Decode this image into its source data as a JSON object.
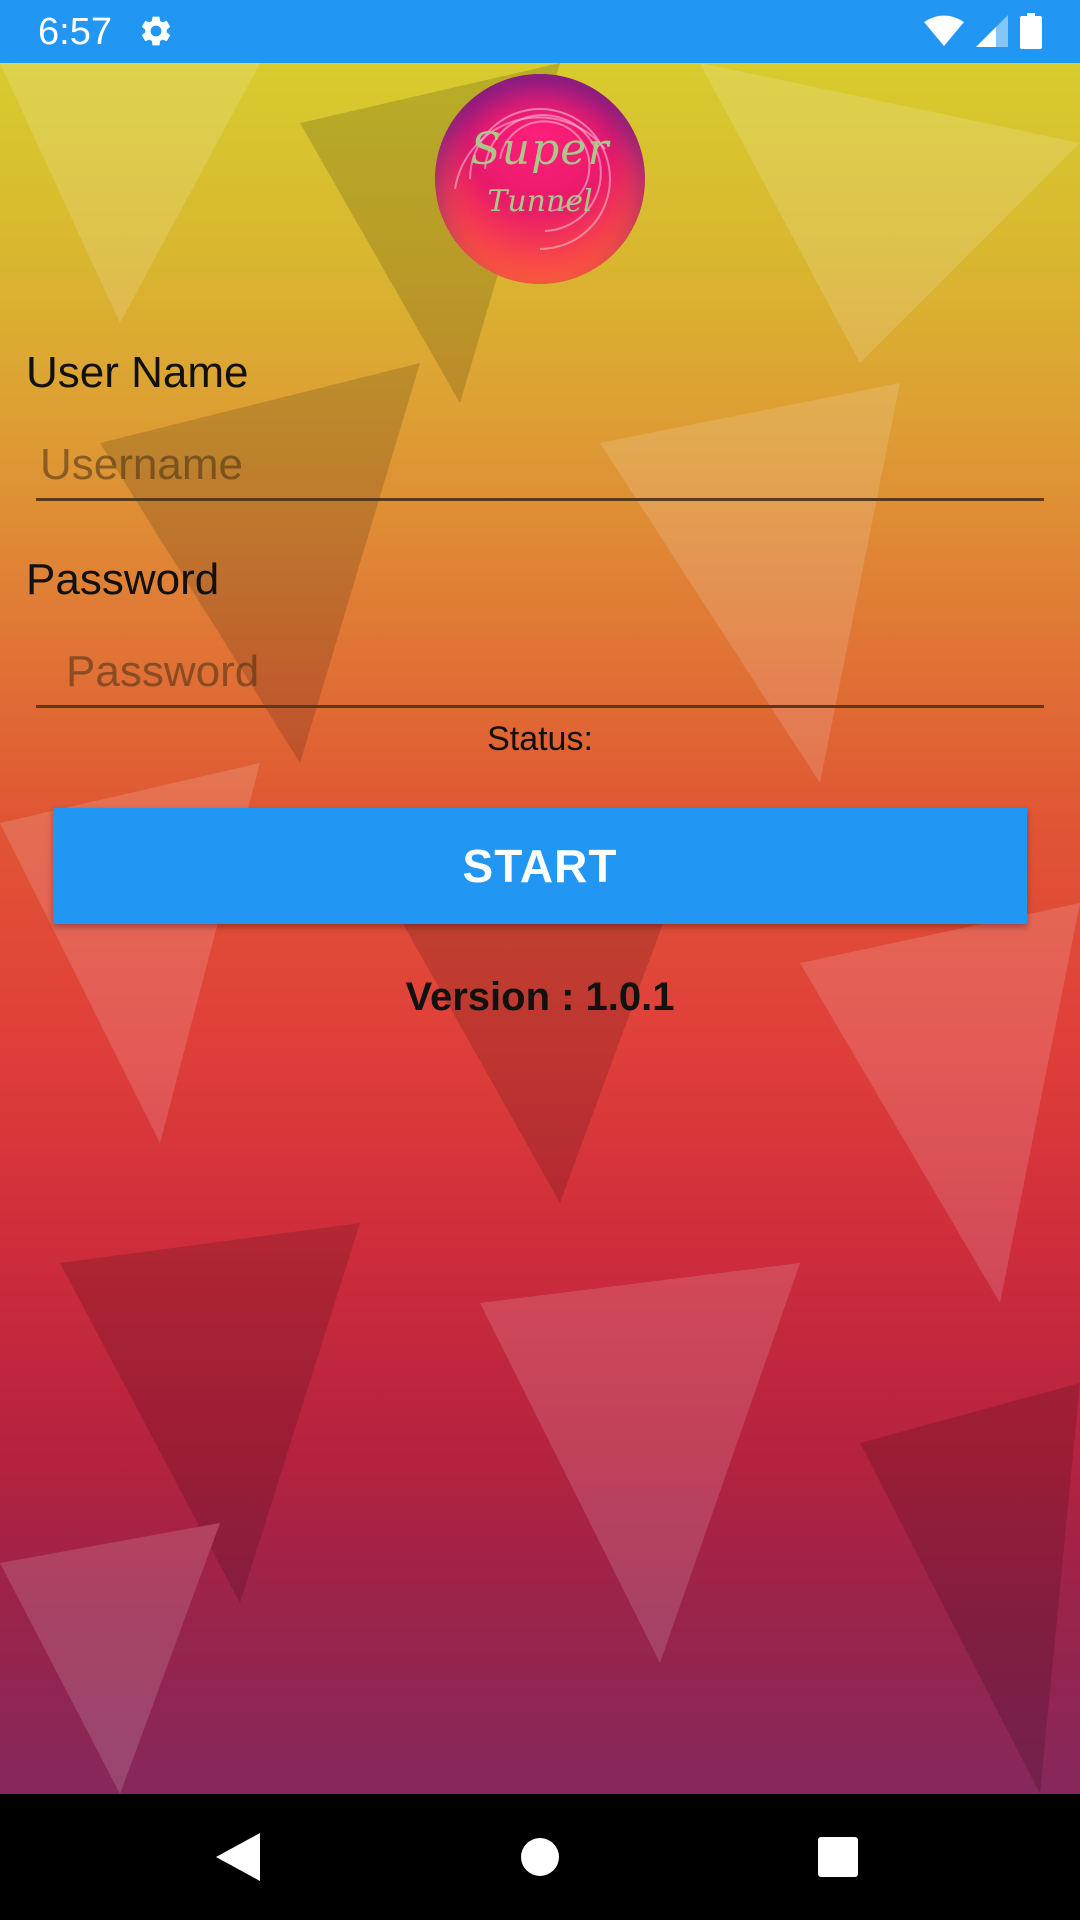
{
  "status_bar": {
    "time": "6:57",
    "icons": [
      "gear-icon",
      "wifi-icon",
      "signal-icon",
      "battery-icon"
    ],
    "color": "#2196F3"
  },
  "logo": {
    "line1": "Super",
    "line2": "Tunnel"
  },
  "form": {
    "username_label": "User Name",
    "username_placeholder": "Username",
    "username_value": "",
    "password_label": "Password",
    "password_placeholder": "Password",
    "password_value": ""
  },
  "status": {
    "label": "Status:"
  },
  "start_button": {
    "label": "START",
    "color": "#2196F3"
  },
  "version": {
    "text": "Version : 1.0.1"
  },
  "nav_bar": {
    "buttons": [
      "back-icon",
      "home-icon",
      "recents-icon"
    ]
  }
}
